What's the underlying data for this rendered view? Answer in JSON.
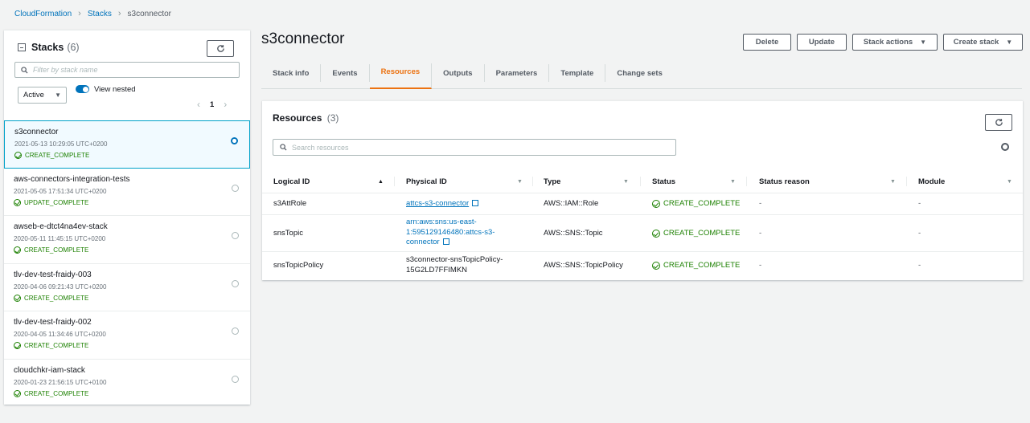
{
  "breadcrumb": {
    "root": "CloudFormation",
    "section": "Stacks",
    "current": "s3connector"
  },
  "sidebar": {
    "title": "Stacks",
    "count": "(6)",
    "filter_placeholder": "Filter by stack name",
    "status_filter": "Active",
    "view_nested_label": "View nested",
    "view_nested_on": true,
    "page": "1",
    "stacks": [
      {
        "name": "s3connector",
        "date": "2021-05-13 10:29:05 UTC+0200",
        "status": "CREATE_COMPLETE",
        "selected": true
      },
      {
        "name": "aws-connectors-integration-tests",
        "date": "2021-05-05 17:51:34 UTC+0200",
        "status": "UPDATE_COMPLETE",
        "selected": false
      },
      {
        "name": "awseb-e-dtct4na4ev-stack",
        "date": "2020-05-11 11:45:15 UTC+0200",
        "status": "CREATE_COMPLETE",
        "selected": false
      },
      {
        "name": "tlv-dev-test-fraidy-003",
        "date": "2020-04-06 09:21:43 UTC+0200",
        "status": "CREATE_COMPLETE",
        "selected": false
      },
      {
        "name": "tlv-dev-test-fraidy-002",
        "date": "2020-04-05 11:34:46 UTC+0200",
        "status": "CREATE_COMPLETE",
        "selected": false
      },
      {
        "name": "cloudchkr-iam-stack",
        "date": "2020-01-23 21:56:15 UTC+0100",
        "status": "CREATE_COMPLETE",
        "selected": false
      }
    ]
  },
  "header": {
    "title": "s3connector",
    "buttons": {
      "delete": "Delete",
      "update": "Update",
      "stack_actions": "Stack actions",
      "create_stack": "Create stack"
    }
  },
  "tabs": [
    "Stack info",
    "Events",
    "Resources",
    "Outputs",
    "Parameters",
    "Template",
    "Change sets"
  ],
  "active_tab": "Resources",
  "resources": {
    "title": "Resources",
    "count": "(3)",
    "search_placeholder": "Search resources",
    "columns": [
      "Logical ID",
      "Physical ID",
      "Type",
      "Status",
      "Status reason",
      "Module"
    ],
    "rows": [
      {
        "logical_id": "s3AttRole",
        "physical_id_lines": [
          "attcs-s3-connector"
        ],
        "physical_link": true,
        "type": "AWS::IAM::Role",
        "status": "CREATE_COMPLETE",
        "status_reason": "-",
        "module": "-"
      },
      {
        "logical_id": "snsTopic",
        "physical_id_lines": [
          "arn:aws:sns:us-east-",
          "1:595129146480:attcs-s3-",
          "connector"
        ],
        "physical_link": true,
        "type": "AWS::SNS::Topic",
        "status": "CREATE_COMPLETE",
        "status_reason": "-",
        "module": "-"
      },
      {
        "logical_id": "snsTopicPolicy",
        "physical_id_lines": [
          "s3connector-snsTopicPolicy-",
          "15G2LD7FFIMKN"
        ],
        "physical_link": false,
        "type": "AWS::SNS::TopicPolicy",
        "status": "CREATE_COMPLETE",
        "status_reason": "-",
        "module": "-"
      }
    ]
  },
  "colors": {
    "link": "#0073bb",
    "success": "#1d8102",
    "accent": "#ec7211",
    "selected_border": "#00a1c9"
  }
}
